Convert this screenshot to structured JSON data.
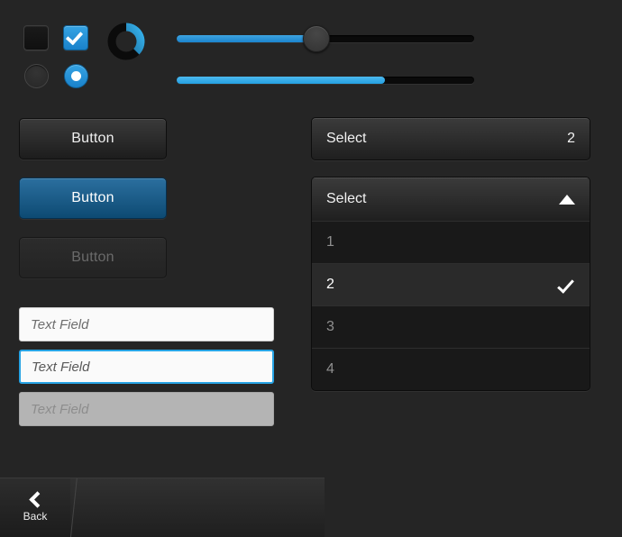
{
  "theme": {
    "background": "#252525",
    "accent_blue": "#2196dd",
    "accent_blue_bright": "#2ba8e8",
    "button_active_blue": "#0e4a73",
    "text_primary": "#f0f0f0",
    "text_disabled": "#6a6a6a"
  },
  "toggles": {
    "checkbox_unchecked": {
      "name": "checkbox",
      "checked": false
    },
    "checkbox_checked": {
      "name": "checkbox",
      "checked": true
    },
    "radio_unselected": {
      "name": "radio",
      "selected": false
    },
    "radio_selected": {
      "name": "radio",
      "selected": true
    },
    "spinner": {
      "name": "activity-indicator",
      "arc_percent": 30
    }
  },
  "sliders": [
    {
      "name": "slider",
      "value_percent": 47,
      "has_thumb": true
    },
    {
      "name": "progress-bar",
      "value_percent": 70,
      "has_thumb": false
    }
  ],
  "buttons": [
    {
      "label": "Button",
      "state": "normal"
    },
    {
      "label": "Button",
      "state": "active"
    },
    {
      "label": "Button",
      "state": "disabled"
    }
  ],
  "text_fields": [
    {
      "placeholder": "Text Field",
      "value": "",
      "state": "normal"
    },
    {
      "placeholder": "Text Field",
      "value": "",
      "state": "focused"
    },
    {
      "placeholder": "Text Field",
      "value": "",
      "state": "disabled"
    }
  ],
  "select_closed": {
    "label": "Select",
    "value": "2"
  },
  "select_open": {
    "label": "Select",
    "caret": "chevron-up-icon",
    "options": [
      {
        "label": "1",
        "selected": false
      },
      {
        "label": "2",
        "selected": true
      },
      {
        "label": "3",
        "selected": false
      },
      {
        "label": "4",
        "selected": false
      }
    ]
  },
  "bottom_bar": {
    "back": {
      "label": "Back",
      "icon": "chevron-left-icon"
    }
  }
}
